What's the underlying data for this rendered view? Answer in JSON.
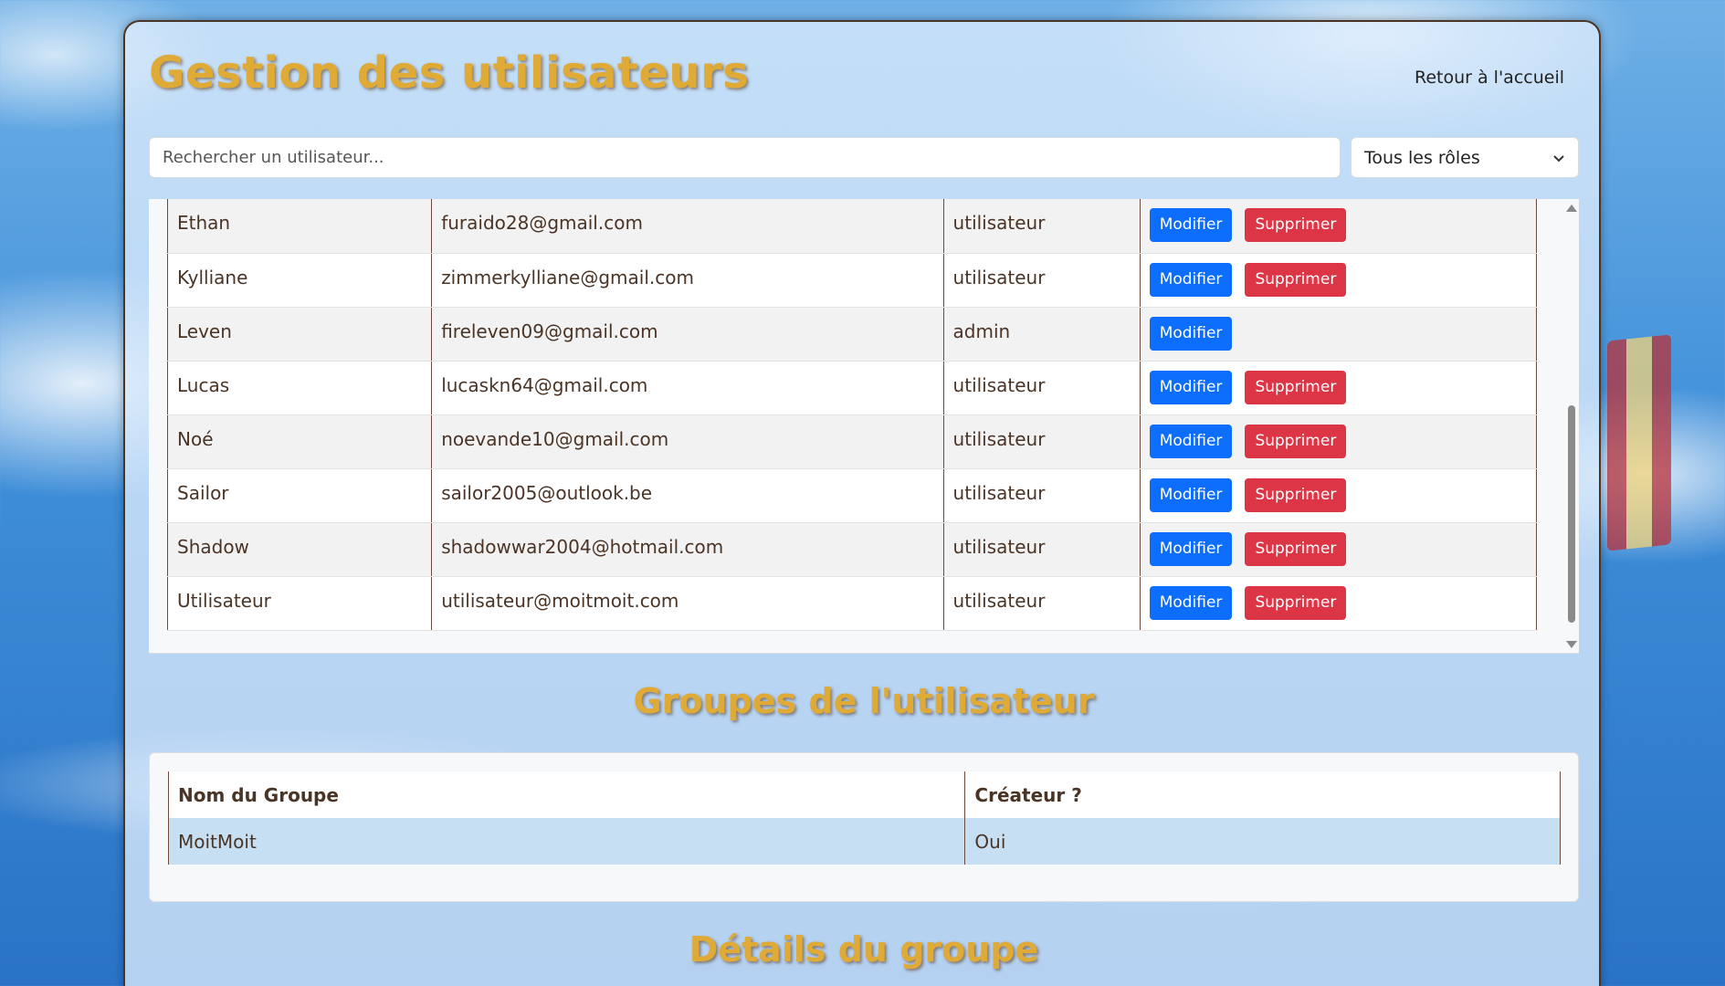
{
  "header": {
    "title": "Gestion des utilisateurs",
    "home_link": "Retour à l'accueil"
  },
  "search": {
    "placeholder": "Rechercher un utilisateur..."
  },
  "role_filter": {
    "selected": "Tous les rôles"
  },
  "users": {
    "modify_label": "Modifier",
    "delete_label": "Supprimer",
    "rows": [
      {
        "name": "Ethan",
        "email": "furaido28@gmail.com",
        "role": "utilisateur",
        "can_delete": true
      },
      {
        "name": "Kylliane",
        "email": "zimmerkylliane@gmail.com",
        "role": "utilisateur",
        "can_delete": true
      },
      {
        "name": "Leven",
        "email": "fireleven09@gmail.com",
        "role": "admin",
        "can_delete": false
      },
      {
        "name": "Lucas",
        "email": "lucaskn64@gmail.com",
        "role": "utilisateur",
        "can_delete": true
      },
      {
        "name": "Noé",
        "email": "noevande10@gmail.com",
        "role": "utilisateur",
        "can_delete": true
      },
      {
        "name": "Sailor",
        "email": "sailor2005@outlook.be",
        "role": "utilisateur",
        "can_delete": true
      },
      {
        "name": "Shadow",
        "email": "shadowwar2004@hotmail.com",
        "role": "utilisateur",
        "can_delete": true
      },
      {
        "name": "Utilisateur",
        "email": "utilisateur@moitmoit.com",
        "role": "utilisateur",
        "can_delete": true
      }
    ]
  },
  "groups": {
    "title": "Groupes de l'utilisateur",
    "columns": [
      "Nom du Groupe",
      "Créateur ?"
    ],
    "rows": [
      {
        "name": "MoitMoit",
        "creator": "Oui"
      }
    ]
  },
  "group_details": {
    "title": "Détails du groupe"
  },
  "colors": {
    "title_gold": "#e0aa36",
    "modify_blue": "#0d6efd",
    "delete_red": "#dc3545",
    "text_brown": "#4a3426",
    "selected_row": "#c6dff2"
  }
}
